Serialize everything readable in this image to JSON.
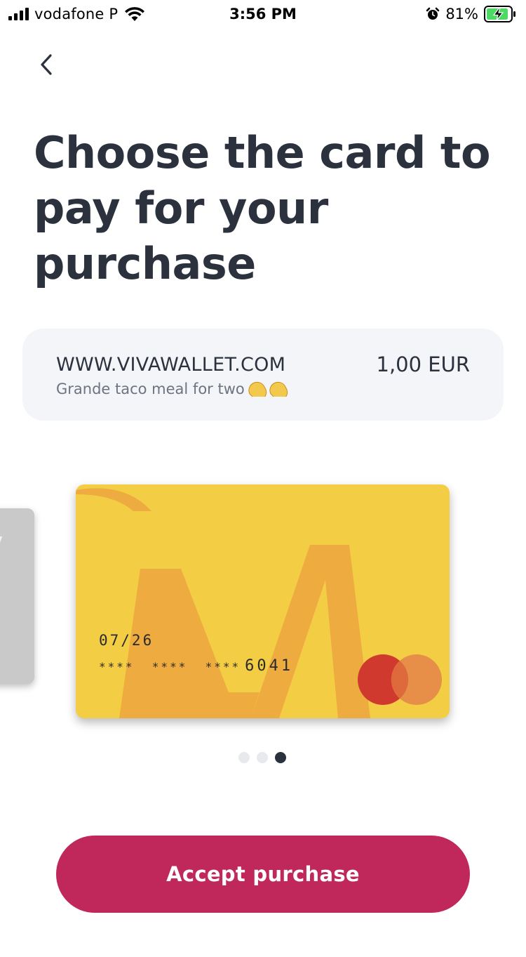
{
  "status_bar": {
    "carrier": "vodafone P",
    "time": "3:56 PM",
    "battery_percent": "81%",
    "icons": [
      "signal-icon",
      "wifi-icon",
      "alarm-icon",
      "battery-charging-icon"
    ]
  },
  "header": {
    "back_icon": "chevron-left-icon"
  },
  "title": "Choose the card to pay for your purchase",
  "merchant": {
    "name": "WWW.VIVAWALLET.COM",
    "description": "Grande taco meal for two",
    "description_icons": [
      "taco-icon",
      "taco-icon"
    ],
    "amount": "1,00 EUR"
  },
  "cards": {
    "selected": {
      "expiry": "07/26",
      "masked_groups": "****  ****  ****",
      "last4": "6041",
      "brand_icon": "mastercard-icon",
      "color": "#f3cd44",
      "art_color": "#eeab3f"
    },
    "previous_card_color": "#c9c9c9"
  },
  "pager": {
    "total": 3,
    "active_index": 3
  },
  "actions": {
    "accept_label": "Accept purchase"
  },
  "colors": {
    "primary": "#c0285c",
    "text_dark": "#2b323e",
    "panel_bg": "#f4f5f9"
  }
}
